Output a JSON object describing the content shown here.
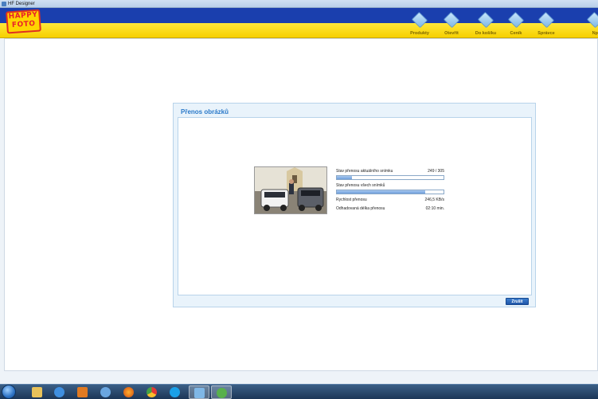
{
  "window": {
    "title": "HF Designer"
  },
  "brand": {
    "logo_line1": "HAPPY",
    "logo_line2": "FOTO"
  },
  "nav": [
    {
      "label": "Produkty",
      "icon": "products-icon"
    },
    {
      "label": "Otevřít",
      "icon": "open-icon"
    },
    {
      "label": "Do košíku",
      "icon": "cart-icon"
    },
    {
      "label": "Ceník",
      "icon": "pricelist-icon"
    },
    {
      "label": "Správce",
      "icon": "manager-icon"
    },
    {
      "label": "Np",
      "icon": "help-icon"
    }
  ],
  "dialog": {
    "title": "Přenos obrázků",
    "current_label": "Stav přenosu aktuálního snímku",
    "current_value": "249 / 305",
    "current_progress": 0.14,
    "all_label": "Stav přenosu všech snímků",
    "all_progress": 0.83,
    "speed_label": "Rychlost přenosu",
    "speed_value": "246,5 KB/s",
    "eta_label": "Odhadovaná délka přenosu",
    "eta_value": "02:10 min.",
    "close_label": "Zrušit"
  },
  "colors": {
    "header_blue": "#1a3fae",
    "header_yellow": "#ffe83a",
    "accent": "#2a79c9"
  },
  "taskbar": {
    "apps": [
      "start-icon",
      "explorer-icon",
      "internet-explorer-icon",
      "media-player-icon",
      "app-icon",
      "firefox-icon",
      "chrome-icon",
      "skype-icon",
      "hf-designer-icon",
      "network-icon"
    ]
  }
}
